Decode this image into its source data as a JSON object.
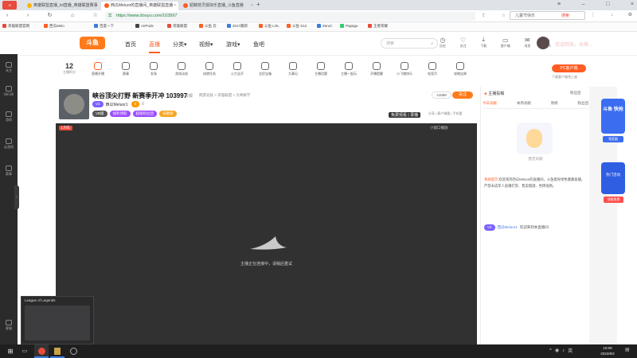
{
  "browser": {
    "tabs": [
      {
        "label": "英雄联盟直播_lol直播_英雄联盟赛事",
        "color": "#ffb400"
      },
      {
        "label": "西瓜Meluor的直播间_英雄联盟直播",
        "color": "#ff5d23"
      },
      {
        "label": "貂蝉技灵狐快乐直播_斗鱼直播",
        "color": "#ff5d23"
      }
    ],
    "new_tab": "+",
    "url": "https://www.douyu.com/103997",
    "search_hint": "儿童节快乐",
    "search_label": "搜索",
    "bookmarks": [
      "英雄联盟官网",
      "西瓜Melo",
      "百度一下",
      "AirPods",
      "英雄联盟",
      "斗鱼 云",
      "2017最新",
      "斗鱼 LOL",
      "斗鱼 S12",
      "ZeroC",
      "Papago",
      "王者荣耀"
    ]
  },
  "site": {
    "logo": "斗鱼",
    "nav": [
      "首页",
      "直播",
      "分类▾",
      "视频▾",
      "游戏▾",
      "鱼吧"
    ],
    "active_nav": "直播",
    "search_placeholder": "搜索",
    "user_menu": [
      "历史",
      "关注",
      "下载",
      "客户端",
      "消息",
      "创作"
    ],
    "user_banner": "欢迎回来，冰尊..."
  },
  "left_sidebar": [
    "关注",
    "排行榜",
    "游戏",
    "云游戏",
    "赛事",
    "客服"
  ],
  "room": {
    "level": "12",
    "level_label": "主播积分",
    "categories": [
      "直播开播",
      "赛事",
      "发表",
      "游戏动态",
      "成就任务",
      "火力全开",
      "全民宝箱",
      "大事记",
      "主播话题",
      "主播一起玩",
      "开播提醒",
      "小飞猪快乐",
      "电竞币",
      "攻略宝典",
      "发布动态",
      "主播口袋",
      "更多"
    ],
    "pc_client": "PC客户端",
    "pc_client_sub": "下载客户端领上座",
    "title": "峡谷顶尖打野 新赛季开冲 103997",
    "report": "举报",
    "category_path": "网游竞技 > 英雄联盟 > 大神解学",
    "streamer_badge": "V3",
    "streamer": "西瓜Meluor1",
    "fans_badge": "5",
    "follow_count": "0",
    "pills": [
      {
        "label": "VB级",
        "color": "#555"
      },
      {
        "label": "福利领取",
        "color": "#9b4dff"
      },
      {
        "label": "超级粉丝团",
        "color": "#9b4dff"
      },
      {
        "label": "贡献榜",
        "color": "#f5a623"
      }
    ],
    "follow_num": "41868",
    "follow_btn": "关注",
    "live_badge": "LIVE",
    "share": "分享",
    "video_links": "分享 | 客户端看 | 手机看"
  },
  "video": {
    "status": "主播正在连接中，请稍后重试",
    "top_badge": "免费观看 | 录播",
    "top_right": "小窗口播放"
  },
  "side": {
    "notice_tab": "主播投稿",
    "tabs": [
      "今日贡献",
      "本周贡献",
      "周榜",
      "粉丝团"
    ],
    "empty": "暂无贡献",
    "system_label": "系统提示:",
    "system_msg": "欢迎来到西瓜Meluor的直播间，斗鱼倡导绿色健康直播，严禁未成年人直播打赏、售卖烟酒、色情低俗。",
    "chat_user": "西瓜Meluor1",
    "chat_msg": "欢迎来到本直播间",
    "gift_tab": "粉丝团"
  },
  "ads": [
    "斗鱼 快抢",
    "领奖励",
    "热门活动",
    "领取免费"
  ],
  "taskbar": {
    "lol_preview": "League of Legends",
    "time": "10:09",
    "date": "2022/6/2",
    "lang": "英"
  }
}
